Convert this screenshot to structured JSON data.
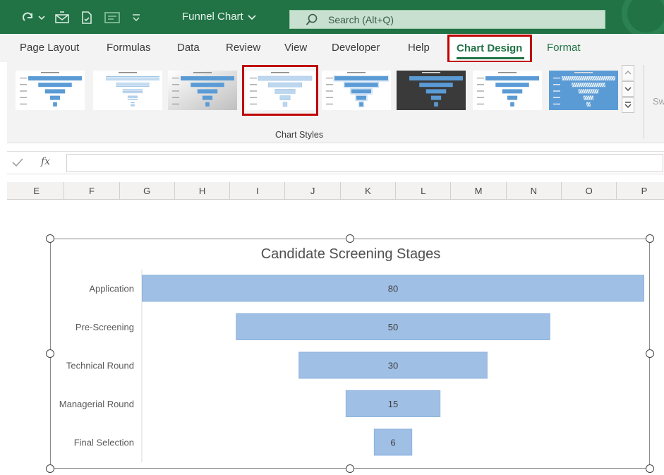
{
  "window": {
    "doc_title": "Funnel Chart",
    "search_placeholder": "Search (Alt+Q)"
  },
  "ribbon": {
    "tabs": [
      "Page Layout",
      "Formulas",
      "Data",
      "Review",
      "View",
      "Developer",
      "Help"
    ],
    "active_tab": "Chart Design",
    "extra_tab": "Format",
    "gallery_label": "Chart Styles",
    "clipped_text": "Sw",
    "selected_style_index": 3
  },
  "formula_bar": {
    "fx": "fx",
    "value": ""
  },
  "columns": [
    "E",
    "F",
    "G",
    "H",
    "I",
    "J",
    "K",
    "L",
    "M",
    "N",
    "O",
    "P"
  ],
  "colors": {
    "excel_green": "#217346",
    "highlight_red": "#c00000",
    "bar_fill": "#9fbfe5",
    "bar_stroke": "#8eb3de"
  },
  "chart_data": {
    "type": "bar",
    "subtype": "funnel",
    "title": "Candidate Screening Stages",
    "categories": [
      "Application",
      "Pre-Screening",
      "Technical Round",
      "Managerial Round",
      "Final Selection"
    ],
    "values": [
      80,
      50,
      30,
      15,
      6
    ],
    "xlabel": "",
    "ylabel": "",
    "grid": false,
    "legend": "none"
  }
}
